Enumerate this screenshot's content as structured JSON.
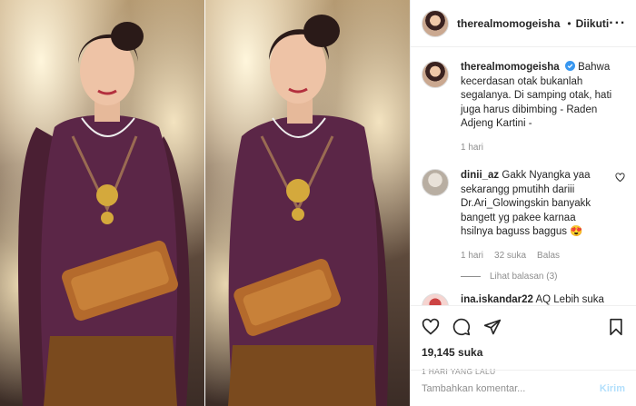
{
  "post": {
    "username": "therealmomogeisha",
    "follow_status": "Diikuti",
    "more_icon": "more-horizontal-icon",
    "colors": {
      "link": "#0095f6",
      "post_disabled": "#b2dffc",
      "muted": "#8e8e8e",
      "dress": "#5b2647"
    }
  },
  "caption": {
    "username": "therealmomogeisha",
    "text": "Bahwa kecerdasan otak bukanlah segalanya. Di samping otak, hati juga harus dibimbing - Raden Adjeng Kartini -",
    "time": "1 hari"
  },
  "comments": [
    {
      "username": "dinii_az",
      "text": "Gakk Nyangka yaa sekarangg pmutihh dariii Dr.Ari_Glowingskin banyakk bangett yg pakee karnaa hsilnya baguss baggus 😍",
      "time": "1 hari",
      "likes": "32 suka",
      "reply": "Balas",
      "view_replies": "Lihat balasan (3)"
    },
    {
      "username": "ina.iskandar22",
      "text": "AQ Lebih suka momo yg dlu cantik Natural yg gk filler filler."
    }
  ],
  "actions": {
    "likes": "19,145 suka",
    "date": "1 HARI YANG LALU"
  },
  "add_comment": {
    "placeholder": "Tambahkan komentar...",
    "post_label": "Kirim"
  }
}
